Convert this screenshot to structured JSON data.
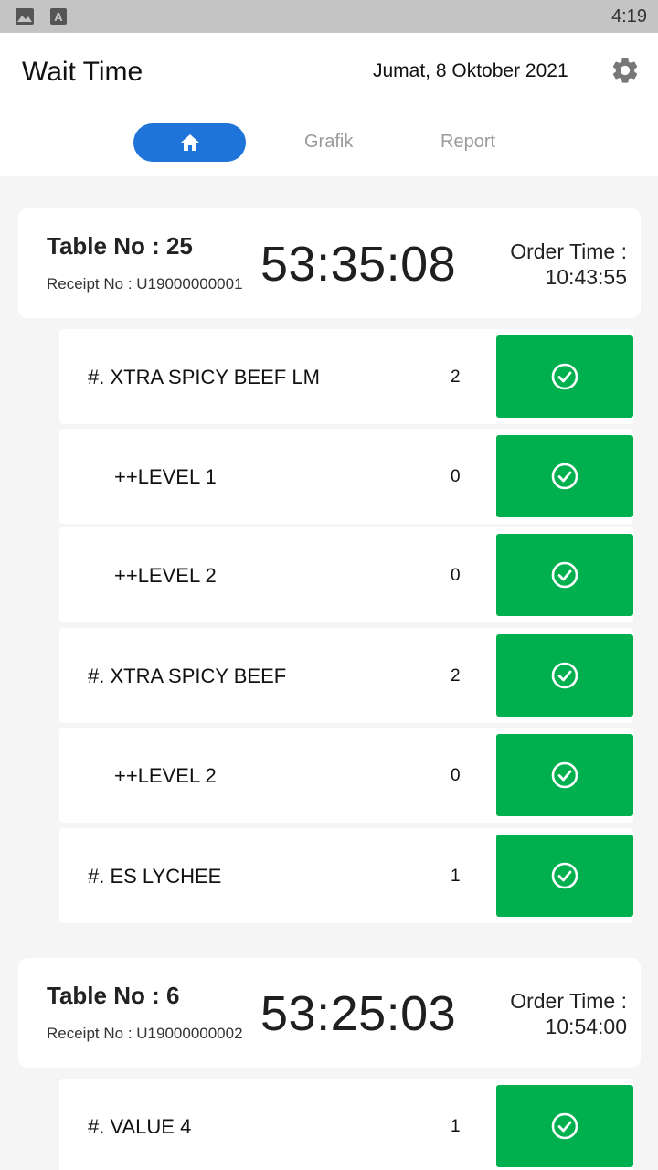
{
  "status_bar": {
    "time": "4:19",
    "icons": [
      "image-icon",
      "font-icon"
    ]
  },
  "header": {
    "title": "Wait Time",
    "date": "Jumat, 8 Oktober 2021",
    "settings_icon": "gear-icon"
  },
  "tabs": {
    "home_icon": "home-icon",
    "grafik": "Grafik",
    "report": "Report",
    "active_color": "#1e74d8"
  },
  "colors": {
    "done_button": "#00b04f"
  },
  "orders": [
    {
      "table": "Table No : 25",
      "receipt": "Receipt No : U19000000001",
      "timer": "53:35:08",
      "order_time_label": "Order Time :",
      "order_time": "10:43:55",
      "items": [
        {
          "name": "#. XTRA SPICY BEEF LM",
          "qty": "2"
        },
        {
          "name": "++LEVEL 1",
          "qty": "0"
        },
        {
          "name": "++LEVEL 2",
          "qty": "0"
        },
        {
          "name": "#. XTRA SPICY BEEF",
          "qty": "2"
        },
        {
          "name": "++LEVEL 2",
          "qty": "0"
        },
        {
          "name": "#. ES LYCHEE",
          "qty": "1"
        }
      ]
    },
    {
      "table": "Table No : 6",
      "receipt": "Receipt No : U19000000002",
      "timer": "53:25:03",
      "order_time_label": "Order Time :",
      "order_time": "10:54:00",
      "items": [
        {
          "name": "#. VALUE 4",
          "qty": "1"
        }
      ]
    }
  ]
}
